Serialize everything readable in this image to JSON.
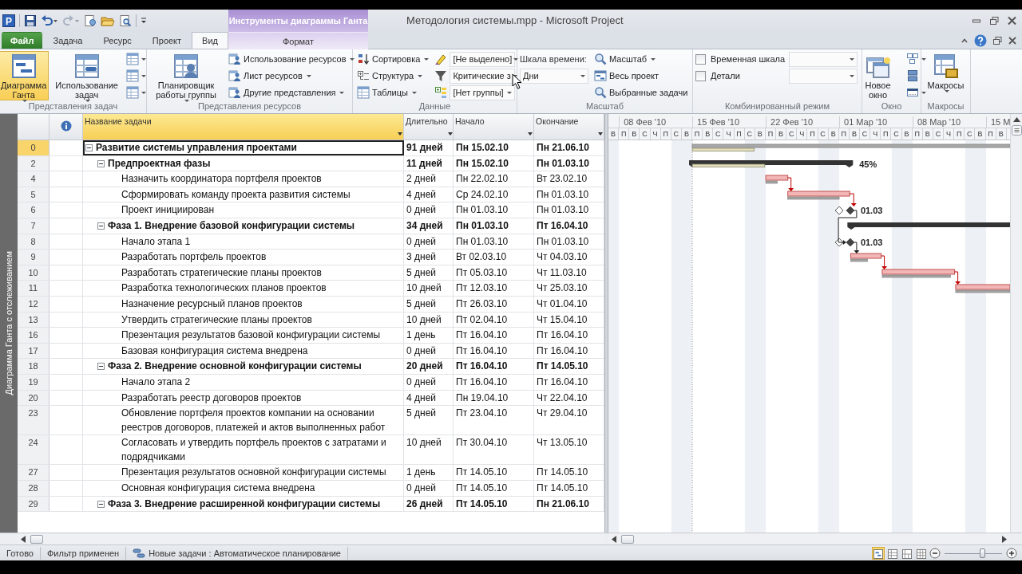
{
  "window": {
    "app_letter": "P",
    "context_group": "Инструменты диаграммы Ганта",
    "title": "Методология системы.mpp - Microsoft Project"
  },
  "ribbon_tabs": [
    {
      "label": "Файл",
      "kind": "file",
      "selected": false
    },
    {
      "label": "Задача",
      "kind": "tab",
      "selected": false
    },
    {
      "label": "Ресурс",
      "kind": "tab",
      "selected": false
    },
    {
      "label": "Проект",
      "kind": "tab",
      "selected": false
    },
    {
      "label": "Вид",
      "kind": "tab",
      "selected": true
    },
    {
      "label": "Формат",
      "kind": "context",
      "selected": false
    }
  ],
  "ribbon_groups": [
    {
      "label": "Представления задач",
      "columns": [
        [
          {
            "kind": "large",
            "label": "Диаграмма Ганта",
            "dropdown": true,
            "selected": true
          }
        ],
        [
          {
            "kind": "large",
            "label": "Использование задач",
            "dropdown": true,
            "selected": false
          }
        ],
        [
          {
            "kind": "icon",
            "dropdown": true
          },
          {
            "kind": "icon",
            "dropdown": true
          },
          {
            "kind": "icon",
            "dropdown": true
          }
        ]
      ]
    },
    {
      "label": "Представления ресурсов",
      "columns": [
        [
          {
            "kind": "large",
            "label": "Планировщик работы группы",
            "dropdown": true
          }
        ],
        [
          {
            "kind": "small",
            "label": "Использование ресурсов",
            "dropdown": true
          },
          {
            "kind": "small",
            "label": "Лист ресурсов",
            "dropdown": true
          },
          {
            "kind": "small",
            "label": "Другие представления",
            "dropdown": true
          }
        ]
      ]
    },
    {
      "label": "Данные",
      "columns": [
        [
          {
            "kind": "small",
            "label": "Сортировка",
            "dropdown": true
          },
          {
            "kind": "small",
            "label": "Структура",
            "dropdown": true
          },
          {
            "kind": "small",
            "label": "Таблицы",
            "dropdown": true
          }
        ],
        [
          {
            "kind": "combo",
            "value": "[Не выделено]"
          },
          {
            "kind": "combo",
            "value": "Критические з"
          },
          {
            "kind": "combo",
            "value": "[Нет группы]"
          }
        ]
      ]
    },
    {
      "label": "Масштаб",
      "columns": [
        [
          {
            "kind": "label",
            "label": "Шкала времени:"
          },
          {
            "kind": "field",
            "value": "Дни"
          }
        ],
        [
          {
            "kind": "small",
            "label": "Масштаб",
            "dropdown": true
          },
          {
            "kind": "small",
            "label": "Весь проект",
            "dropdown": false
          },
          {
            "kind": "small",
            "label": "Выбранные задачи",
            "dropdown": false
          }
        ]
      ]
    },
    {
      "label": "Комбинированный режим",
      "columns": [
        [
          {
            "kind": "check",
            "label": "Временная шкала",
            "checked": false
          },
          {
            "kind": "check",
            "label": "Детали",
            "checked": false
          }
        ],
        [
          {
            "kind": "field"
          },
          {
            "kind": "field"
          }
        ]
      ]
    },
    {
      "label": "Окно",
      "columns": [
        [
          {
            "kind": "large",
            "label": "Новое окно",
            "dropdown": false
          }
        ],
        [
          {
            "kind": "icon",
            "dropdown": true
          },
          {
            "kind": "icon",
            "dropdown": false
          },
          {
            "kind": "icon",
            "dropdown": true
          }
        ]
      ]
    },
    {
      "label": "Макросы",
      "columns": [
        [
          {
            "kind": "large",
            "label": "Макросы",
            "dropdown": true
          }
        ]
      ]
    }
  ],
  "side_label": "Диаграмма Ганта с отслеживанием",
  "table": {
    "columns": [
      {
        "label": "Название задачи",
        "selected": true
      },
      {
        "label": "Длительно",
        "selected": false
      },
      {
        "label": "Начало",
        "selected": false
      },
      {
        "label": "Окончание",
        "selected": false
      }
    ],
    "rows": [
      {
        "id": "0",
        "name": "Развитие системы управления проектами",
        "duration": "91 дней",
        "start": "Пн 15.02.10",
        "finish": "Пн 21.06.10",
        "kind": "summary",
        "expanded": true,
        "selected": true,
        "children": [
          {
            "id": "2",
            "name": "Предпроектная фазы",
            "duration": "11 дней",
            "start": "Пн 15.02.10",
            "finish": "Пн 01.03.10",
            "kind": "summary",
            "expanded": true,
            "selected": false,
            "bar_label": "45%",
            "children": [
              {
                "id": "4",
                "name": "Назначить координатора портфеля проектов",
                "duration": "2 дней",
                "start": "Пн 22.02.10",
                "finish": "Вт 23.02.10",
                "kind": "task",
                "selected": false
              },
              {
                "id": "5",
                "name": "Сформировать команду проекта развития системы",
                "duration": "4 дней",
                "start": "Ср 24.02.10",
                "finish": "Пн 01.03.10",
                "kind": "task",
                "selected": false
              },
              {
                "id": "6",
                "name": "Проект инициирован",
                "duration": "0 дней",
                "start": "Пн 01.03.10",
                "finish": "Пн 01.03.10",
                "kind": "task",
                "selected": false,
                "bar_label": "01.03"
              }
            ]
          },
          {
            "id": "7",
            "name": "Фаза 1. Внедрение базовой конфигурации системы",
            "duration": "34 дней",
            "start": "Пн 01.03.10",
            "finish": "Пт 16.04.10",
            "kind": "summary",
            "expanded": true,
            "selected": false,
            "children": [
              {
                "id": "8",
                "name": "Начало этапа 1",
                "duration": "0 дней",
                "start": "Пн 01.03.10",
                "finish": "Пн 01.03.10",
                "kind": "task",
                "selected": false,
                "bar_label": "01.03"
              },
              {
                "id": "9",
                "name": "Разработать портфель проектов",
                "duration": "3 дней",
                "start": "Вт 02.03.10",
                "finish": "Чт 04.03.10",
                "kind": "task",
                "selected": false
              },
              {
                "id": "10",
                "name": "Разработать стратегические планы проектов",
                "duration": "5 дней",
                "start": "Пт 05.03.10",
                "finish": "Чт 11.03.10",
                "kind": "task",
                "selected": false
              },
              {
                "id": "11",
                "name": "Разработка технологических планов проектов",
                "duration": "10 дней",
                "start": "Пт 12.03.10",
                "finish": "Чт 25.03.10",
                "kind": "task",
                "selected": false
              },
              {
                "id": "12",
                "name": "Назначение ресурсный планов проектов",
                "duration": "5 дней",
                "start": "Пт 26.03.10",
                "finish": "Чт 01.04.10",
                "kind": "task",
                "selected": false
              },
              {
                "id": "13",
                "name": "Утвердить стратегические планы проектов",
                "duration": "10 дней",
                "start": "Пт 02.04.10",
                "finish": "Чт 15.04.10",
                "kind": "task",
                "selected": false
              },
              {
                "id": "16",
                "name": "Презентация результатов базовой конфигурации системы",
                "duration": "1 день",
                "start": "Пт 16.04.10",
                "finish": "Пт 16.04.10",
                "kind": "task",
                "selected": false
              },
              {
                "id": "17",
                "name": "Базовая конфигурация система внедрена",
                "duration": "0 дней",
                "start": "Пт 16.04.10",
                "finish": "Пт 16.04.10",
                "kind": "task",
                "selected": false
              }
            ]
          },
          {
            "id": "18",
            "name": "Фаза 2. Внедрение основной конфигурации системы",
            "duration": "20 дней",
            "start": "Пт 16.04.10",
            "finish": "Пт 14.05.10",
            "kind": "summary",
            "expanded": true,
            "selected": false,
            "children": [
              {
                "id": "19",
                "name": "Начало этапа 2",
                "duration": "0 дней",
                "start": "Пт 16.04.10",
                "finish": "Пт 16.04.10",
                "kind": "task",
                "selected": false
              },
              {
                "id": "20",
                "name": "Разработать реестр договоров проектов",
                "duration": "4 дней",
                "start": "Пн 19.04.10",
                "finish": "Чт 22.04.10",
                "kind": "task",
                "selected": false
              },
              {
                "id": "23",
                "name": "Обновление портфеля проектов компании на основании реестров договоров, платежей и актов выполненных работ",
                "duration": "5 дней",
                "start": "Пт 23.04.10",
                "finish": "Чт 29.04.10",
                "kind": "task",
                "selected": false
              },
              {
                "id": "24",
                "name": "Согласовать и утвердить портфель проектов с затратами и подрядчиками",
                "duration": "10 дней",
                "start": "Пт 30.04.10",
                "finish": "Чт 13.05.10",
                "kind": "task",
                "selected": false
              },
              {
                "id": "27",
                "name": "Презентация результатов основной конфигурации системы",
                "duration": "1 день",
                "start": "Пт 14.05.10",
                "finish": "Пт 14.05.10",
                "kind": "task",
                "selected": false
              },
              {
                "id": "28",
                "name": "Основная конфигурация система внедрена",
                "duration": "0 дней",
                "start": "Пт 14.05.10",
                "finish": "Пт 14.05.10",
                "kind": "task",
                "selected": false
              }
            ]
          },
          {
            "id": "29",
            "name": "Фаза 3. Внедрение расширенной конфигурации системы",
            "duration": "26 дней",
            "start": "Пт 14.05.10",
            "finish": "Пн 21.06.10",
            "kind": "summary",
            "expanded": true,
            "selected": false
          }
        ]
      }
    ]
  },
  "gantt": {
    "weeks": [
      "08 Фев '10",
      "15 Фев '10",
      "22 Фев '10",
      "01 Мар '10",
      "08 Мар '10",
      "15 М"
    ],
    "days": [
      "В",
      "П",
      "В",
      "С",
      "Ч",
      "П",
      "С",
      "В",
      "П",
      "В",
      "С",
      "Ч",
      "П",
      "С",
      "В",
      "П",
      "В",
      "С",
      "Ч",
      "П",
      "С",
      "В",
      "П",
      "В",
      "С",
      "Ч",
      "П",
      "С",
      "В",
      "П",
      "В",
      "С",
      "Ч",
      "П",
      "С",
      "В",
      "П",
      "В"
    ]
  },
  "status_bar": {
    "items": [
      {
        "text": "Готово",
        "kind": "plain"
      },
      {
        "text": "Фильтр применен",
        "kind": "plain"
      },
      {
        "text": "Новые задачи : Автоматическое планирование",
        "kind": "mode"
      }
    ],
    "views": [
      {
        "selected": true
      },
      {
        "selected": false
      },
      {
        "selected": false
      },
      {
        "selected": false
      }
    ],
    "zoom": {
      "level": 0.65
    }
  }
}
